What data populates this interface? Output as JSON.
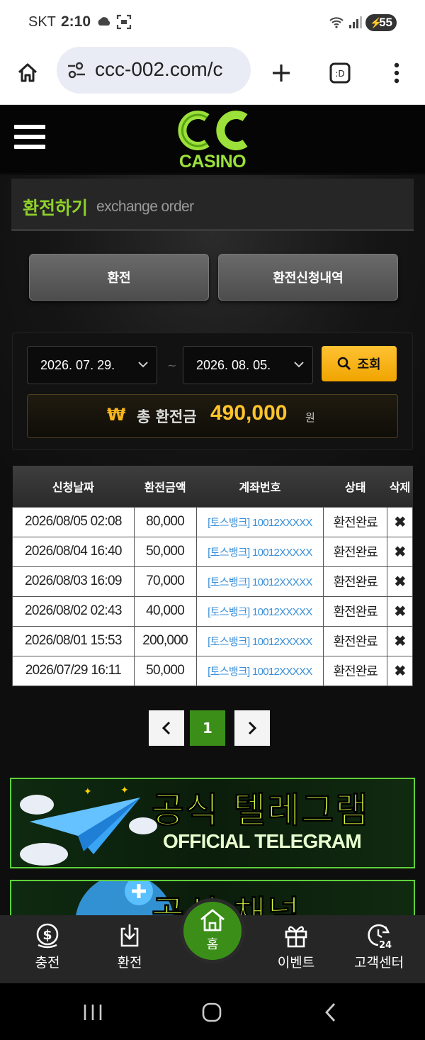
{
  "status_bar": {
    "carrier": "SKT",
    "time": "2:10",
    "battery": "55"
  },
  "browser": {
    "url": "ccc-002.com/c"
  },
  "site": {
    "logo_text": "CASINO",
    "brand_color": "#8fd12a"
  },
  "page": {
    "title_ko": "환전하기",
    "title_en": "exchange order",
    "tabs": [
      {
        "label": "환전"
      },
      {
        "label": "환전신청내역"
      }
    ]
  },
  "filter": {
    "start_date": "2026. 07. 29.",
    "separator": "~",
    "end_date": "2026. 08. 05.",
    "search_label": "조회",
    "total_symbol": "₩",
    "total_label": "총 환전금",
    "total_amount": "490,000",
    "total_unit": "원"
  },
  "table": {
    "headers": [
      "신청날짜",
      "환전금액",
      "계좌번호",
      "상태",
      "삭제"
    ],
    "rows": [
      {
        "date": "2026/08/05 02:08",
        "amount": "80,000",
        "account": "[토스뱅크] 10012XXXXX",
        "status": "환전완료",
        "delete": "✖"
      },
      {
        "date": "2026/08/04 16:40",
        "amount": "50,000",
        "account": "[토스뱅크] 10012XXXXX",
        "status": "환전완료",
        "delete": "✖"
      },
      {
        "date": "2026/08/03 16:09",
        "amount": "70,000",
        "account": "[토스뱅크] 10012XXXXX",
        "status": "환전완료",
        "delete": "✖"
      },
      {
        "date": "2026/08/02 02:43",
        "amount": "40,000",
        "account": "[토스뱅크] 10012XXXXX",
        "status": "환전완료",
        "delete": "✖"
      },
      {
        "date": "2026/08/01 15:53",
        "amount": "200,000",
        "account": "[토스뱅크] 10012XXXXX",
        "status": "환전완료",
        "delete": "✖"
      },
      {
        "date": "2026/07/29 16:11",
        "amount": "50,000",
        "account": "[토스뱅크] 10012XXXXX",
        "status": "환전완료",
        "delete": "✖"
      }
    ]
  },
  "pagination": {
    "prev": "‹",
    "current": "1",
    "next": "›"
  },
  "banners": [
    {
      "title": "공식 텔레그램",
      "subtitle": "OFFICIAL TELEGRAM"
    },
    {
      "title": "공식 채널"
    }
  ],
  "bottom_nav": {
    "items": [
      {
        "label": "충전",
        "icon": "dollar-coin-icon"
      },
      {
        "label": "환전",
        "icon": "download-icon"
      },
      {
        "label": "홈",
        "icon": "home-icon"
      },
      {
        "label": "이벤트",
        "icon": "gift-icon"
      },
      {
        "label": "고객센터",
        "icon": "support-24-icon"
      }
    ]
  }
}
